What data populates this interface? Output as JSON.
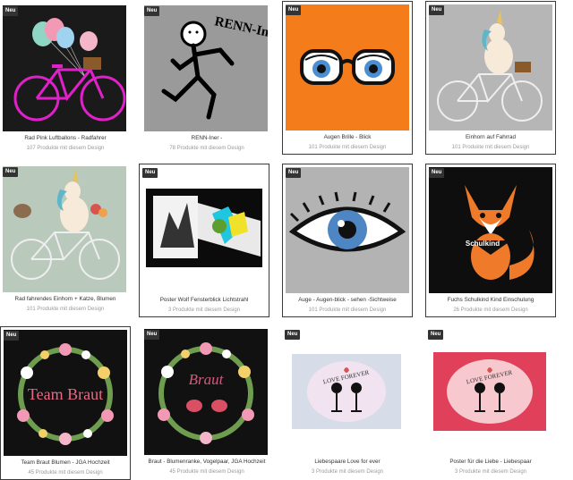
{
  "products": [
    {
      "badge": "Neu",
      "title": "Rad Pink Luftballons - Radfahrer",
      "count": "107 Produkte mit diesem Design",
      "image": "pink-bicycle-balloons"
    },
    {
      "badge": "Neu",
      "title": "RENN-Iner -",
      "count": "78 Produkte mit diesem Design",
      "image": "running-stickman",
      "art_text": "RENN-Iner"
    },
    {
      "badge": "Neu",
      "title": "Augen Brille - Blick",
      "count": "101 Produkte mit diesem Design",
      "image": "eyes-glasses"
    },
    {
      "badge": "Neu",
      "title": "Einhorn auf Fahrrad",
      "count": "101 Produkte mit diesem Design",
      "image": "unicorn-bicycle"
    },
    {
      "badge": "Neu",
      "title": "Rad fahrendes Einhorn + Katze, Blumen",
      "count": "101 Produkte mit diesem Design",
      "image": "unicorn-cat-bicycle"
    },
    {
      "badge": "Neu",
      "title": "Poster Wolf Fensterblick Lichtstrahl",
      "count": "3 Produkte mit diesem Design",
      "image": "wolf-window-poster"
    },
    {
      "badge": "Neu",
      "title": "Auge - Augen-blick - sehen -Sichtweise",
      "count": "101 Produkte mit diesem Design",
      "image": "eye-closeup"
    },
    {
      "badge": "Neu",
      "title": "Fuchs Schulkind Kind Einschulung",
      "count": "26 Produkte mit diesem Design",
      "image": "fox-schulkind",
      "art_text": "Schulkind"
    },
    {
      "badge": "Neu",
      "title": "Team Braut Blumen - JGA Hochzeit",
      "count": "45 Produkte mit diesem Design",
      "image": "flower-wreath-team-braut",
      "art_text": "Team Braut"
    },
    {
      "badge": "Neu",
      "title": "Braut - Blumenranke, Vogelpaar, JGA Hochzeit",
      "count": "45 Produkte mit diesem Design",
      "image": "flower-wreath-braut-birds",
      "art_text": "Braut"
    },
    {
      "badge": "Neu",
      "title": "Liebespaare Love for ever",
      "count": "3 Produkte mit diesem Design",
      "image": "love-forever-poster-blue",
      "art_text": "LOVE FOREVER"
    },
    {
      "badge": "Neu",
      "title": "Poster für die Liebe - Liebespaar",
      "count": "3 Produkte mit diesem Design",
      "image": "love-forever-poster-red",
      "art_text": "LOVE FOREVER"
    }
  ]
}
